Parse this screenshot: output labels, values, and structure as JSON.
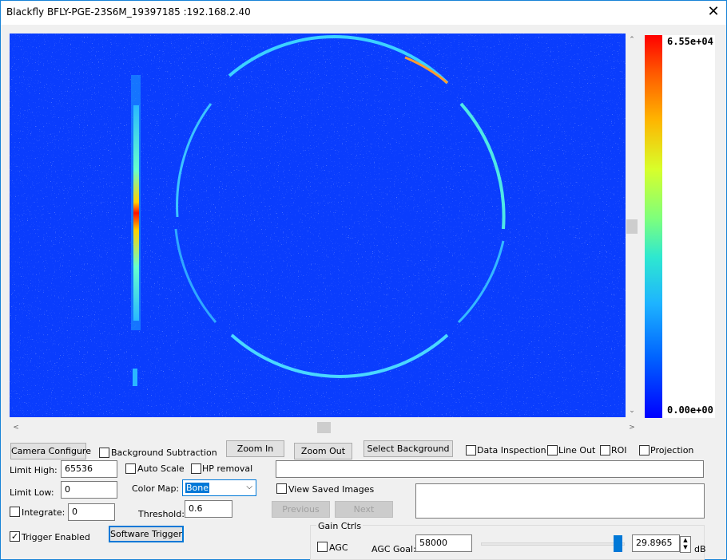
{
  "window": {
    "title": "Blackfly BFLY-PGE-23S6M_19397185 :192.168.2.40",
    "close_glyph": "✕"
  },
  "colorbar": {
    "max_label": "6.55e+04",
    "min_label": "0.00e+00"
  },
  "colors": {
    "accent": "#0078d7",
    "image_bg": "#0a3dfd"
  },
  "scrollbars": {
    "up": "⌃",
    "down": "⌄",
    "left": "<",
    "right": ">"
  },
  "toolbar": {
    "camera_configure": "Camera Configure",
    "background_subtraction": "Background Subtraction",
    "zoom_in": "Zoom In",
    "zoom_out": "Zoom Out",
    "select_background": "Select Background",
    "data_inspection": "Data Inspection",
    "line_out": "Line Out",
    "roi": "ROI",
    "projection": "Projection"
  },
  "limits": {
    "high_label": "Limit High:",
    "high_value": "65536",
    "low_label": "Limit Low:",
    "low_value": "0"
  },
  "options": {
    "auto_scale": "Auto Scale",
    "hp_removal": "HP removal",
    "color_map_label": "Color Map:",
    "color_map_value": "Bone",
    "threshold_label": "Threshold:",
    "threshold_value": "0.6"
  },
  "integrate": {
    "label": "Integrate:",
    "value": "0"
  },
  "trigger": {
    "enabled_label": "Trigger Enabled",
    "enabled_checked": "✓",
    "software_trigger": "Software Trigger"
  },
  "saved": {
    "view_saved_images": "View Saved Images",
    "previous": "Previous",
    "next": "Next"
  },
  "gain": {
    "group_label": "Gain Ctrls",
    "agc": "AGC",
    "agc_goal_label": "AGC Goal:",
    "agc_goal_value": "58000",
    "gain_value": "29.8965",
    "unit": "dB",
    "spin_up": "▲",
    "spin_down": "▼"
  }
}
